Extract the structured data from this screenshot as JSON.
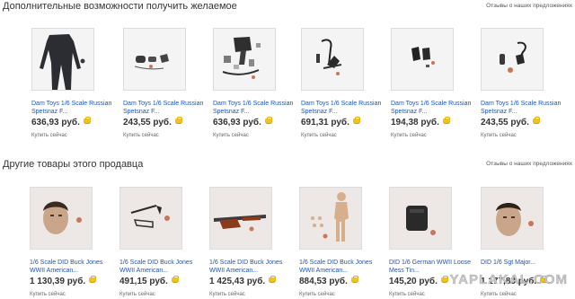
{
  "section_recommended": {
    "title": "Дополнительные возможности получить желаемое",
    "feedback_link": "Отзывы о наших предложениях",
    "items": [
      {
        "title": "Dam Toys 1/6 Scale Russian Spetsnaz F...",
        "price": "636,93 руб.",
        "buy": "Купить сейчас"
      },
      {
        "title": "Dam Toys 1/6 Scale Russian Spetsnaz F...",
        "price": "243,55 руб.",
        "buy": "Купить сейчас"
      },
      {
        "title": "Dam Toys 1/6 Scale Russian Spetsnaz F...",
        "price": "636,93 руб.",
        "buy": "Купить сейчас"
      },
      {
        "title": "Dam Toys 1/6 Scale Russian Spetsnaz F...",
        "price": "691,31 руб.",
        "buy": "Купить сейчас"
      },
      {
        "title": "Dam Toys 1/6 Scale Russian Spetsnaz F...",
        "price": "194,38 руб.",
        "buy": "Купить сейчас"
      },
      {
        "title": "Dam Toys 1/6 Scale Russian Spetsnaz F...",
        "price": "243,55 руб.",
        "buy": "Купить сейчас"
      }
    ]
  },
  "section_seller": {
    "title": "Другие товары этого продавца",
    "feedback_link": "Отзывы о наших предложениях",
    "items": [
      {
        "title": "1/6 Scale DID Buck Jones WWII American...",
        "price": "1 130,39 руб.",
        "buy": "Купить сейчас"
      },
      {
        "title": "1/6 Scale DID Buck Jones WWII American...",
        "price": "491,15 руб.",
        "buy": "Купить сейчас"
      },
      {
        "title": "1/6 Scale DID Buck Jones WWII American...",
        "price": "1 425,43 руб.",
        "buy": "Купить сейчас"
      },
      {
        "title": "1/6 Scale DID Buck Jones WWII American...",
        "price": "884,53 руб.",
        "buy": "Купить сейчас"
      },
      {
        "title": "DID 1/6 German WWII Loose Mess Tin...",
        "price": "145,20 руб.",
        "buy": "Купить сейчас"
      },
      {
        "title": "DID 1/6 Sgt Major...",
        "price": "1 177,83 руб.",
        "buy": "Купить сейчас"
      }
    ]
  },
  "watermark": "YAPLAKAL.COM",
  "colors": {
    "link": "#1a55b8",
    "price": "#333333",
    "coin": "#f1c31e"
  },
  "icons": {
    "price_badge": "coin-purse-icon"
  }
}
